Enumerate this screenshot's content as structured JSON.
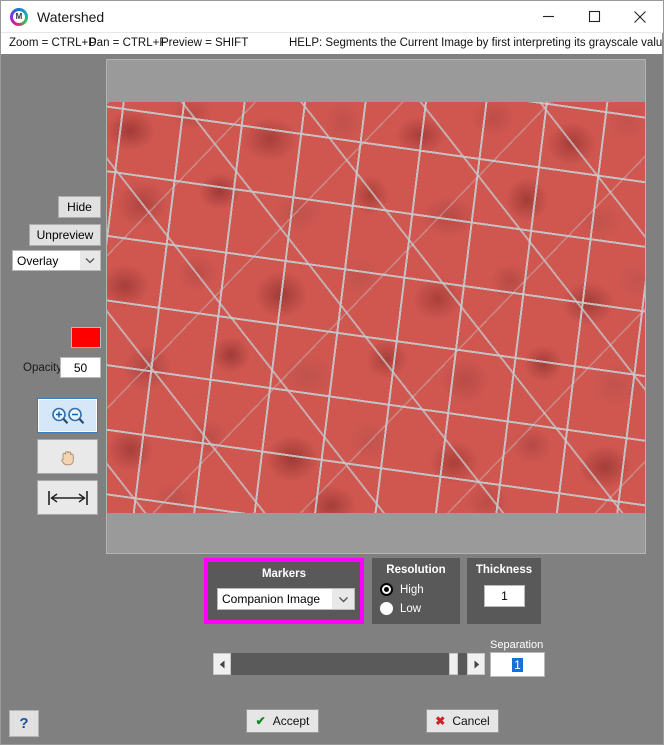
{
  "window": {
    "title": "Watershed",
    "icon": "mipar-logo-icon",
    "controls": {
      "minimize": "minimize-icon",
      "maximize": "maximize-icon",
      "close": "close-icon"
    }
  },
  "menustrip": {
    "zoom_shortcut": "Zoom = CTRL+D",
    "pan_shortcut": "Pan = CTRL+F",
    "preview_shortcut": "Preview = SHIFT",
    "help_text": "HELP:  Segments the Current Image by first interpreting its grayscale values as topo"
  },
  "sidebar": {
    "hide_label": "Hide",
    "unpreview_label": "Unpreview",
    "overlay_mode": "Overlay",
    "overlay_caret": "chevron-down-icon",
    "overlay_color": "#FF0000",
    "opacity_label": "Opacity:",
    "opacity_value": "50",
    "tools": [
      {
        "name": "zoom-tool",
        "icon": "zoom-in-out-icon",
        "active": true
      },
      {
        "name": "pan-tool",
        "icon": "hand-icon",
        "active": false
      },
      {
        "name": "fit-width-tool",
        "icon": "horizontal-arrows-icon",
        "active": false
      }
    ],
    "help_button_label": "?"
  },
  "markers": {
    "title": "Markers",
    "value": "Companion Image",
    "caret": "chevron-down-icon",
    "highlight_color": "#FF00FF"
  },
  "resolution": {
    "title": "Resolution",
    "options": [
      {
        "label": "High",
        "selected": true
      },
      {
        "label": "Low",
        "selected": false
      }
    ]
  },
  "thickness": {
    "title": "Thickness",
    "value": "1"
  },
  "separation": {
    "label": "Separation",
    "value": "1",
    "slider_left_arrow": "left-arrow-icon",
    "slider_right_arrow": "right-arrow-icon",
    "thumb_position_percent": 96
  },
  "actions": {
    "accept_label": "Accept",
    "accept_icon": "check-icon",
    "cancel_label": "Cancel",
    "cancel_icon": "x-icon"
  },
  "canvas": {
    "name": "watershed-preview-canvas",
    "description": "Red overlay watershed segmentation of cellular grain structure"
  }
}
